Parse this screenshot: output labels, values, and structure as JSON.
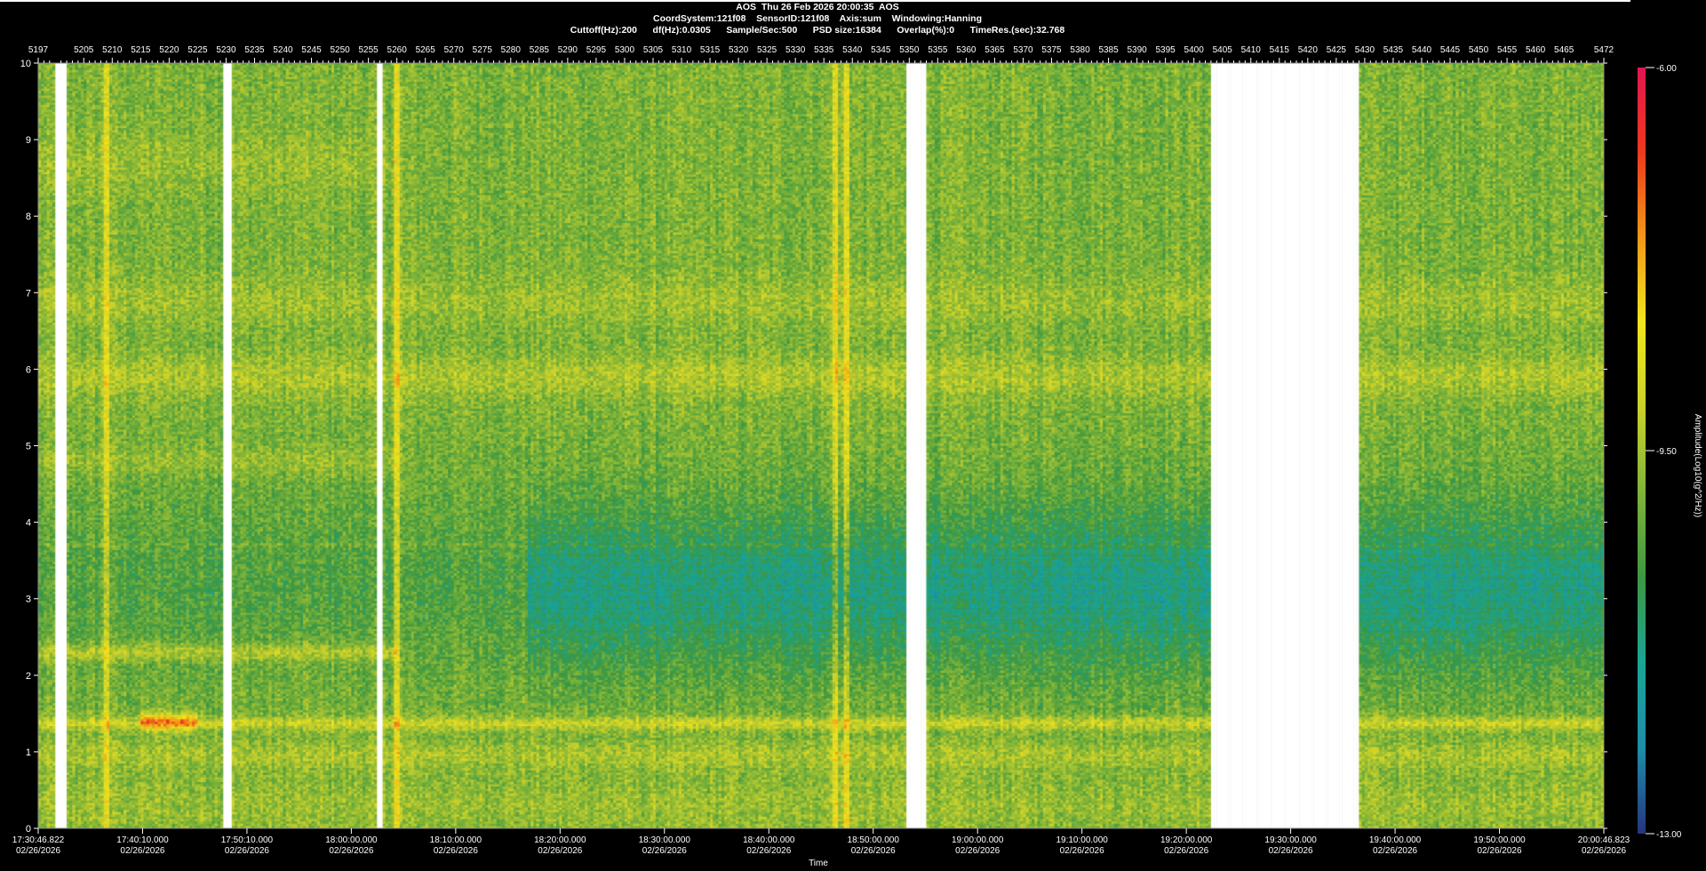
{
  "header": {
    "line1": "AOS  Thu 26 Feb 2026 20:00:35  AOS",
    "line2": "CoordSystem:121f08    SensorID:121f08    Axis:sum    Windowing:Hanning",
    "line3": "Cuttoff(Hz):200      df(Hz):0.0305      Sample/Sec:500      PSD size:16384      Overlap(%):0      TimeRes.(sec):32.768"
  },
  "chart_data": {
    "type": "heatmap",
    "title": "AOS  Thu 26 Feb 2026 20:00:35  AOS",
    "xlabel": "Time",
    "ylabel": "",
    "colorbar_label": "Amplitude(Log10(g^2/Hz))",
    "ylim": [
      0,
      10
    ],
    "yticks": [
      0,
      1,
      2,
      3,
      4,
      5,
      6,
      7,
      8,
      9,
      10
    ],
    "top_index_range": [
      5197,
      5472
    ],
    "top_ticks": [
      5197,
      5205,
      5210,
      5215,
      5220,
      5225,
      5230,
      5235,
      5240,
      5245,
      5250,
      5255,
      5260,
      5265,
      5270,
      5275,
      5280,
      5285,
      5290,
      5295,
      5300,
      5305,
      5310,
      5315,
      5320,
      5325,
      5330,
      5335,
      5340,
      5345,
      5350,
      5355,
      5360,
      5365,
      5370,
      5375,
      5380,
      5385,
      5390,
      5395,
      5400,
      5405,
      5410,
      5415,
      5420,
      5425,
      5430,
      5435,
      5440,
      5445,
      5450,
      5455,
      5460,
      5465,
      5472
    ],
    "time_ticks": [
      {
        "time": "17:30:46.822",
        "date": "02/26/2026"
      },
      {
        "time": "17:40:10.000",
        "date": "02/26/2026"
      },
      {
        "time": "17:50:10.000",
        "date": "02/26/2026"
      },
      {
        "time": "18:00:00.000",
        "date": "02/26/2026"
      },
      {
        "time": "18:10:00.000",
        "date": "02/26/2026"
      },
      {
        "time": "18:20:00.000",
        "date": "02/26/2026"
      },
      {
        "time": "18:30:00.000",
        "date": "02/26/2026"
      },
      {
        "time": "18:40:00.000",
        "date": "02/26/2026"
      },
      {
        "time": "18:50:00.000",
        "date": "02/26/2026"
      },
      {
        "time": "19:00:00.000",
        "date": "02/26/2026"
      },
      {
        "time": "19:10:00.000",
        "date": "02/26/2026"
      },
      {
        "time": "19:20:00.000",
        "date": "02/26/2026"
      },
      {
        "time": "19:30:00.000",
        "date": "02/26/2026"
      },
      {
        "time": "19:40:00.000",
        "date": "02/26/2026"
      },
      {
        "time": "19:50:00.000",
        "date": "02/26/2026"
      },
      {
        "time": "20:00:46.823",
        "date": "02/26/2026"
      }
    ],
    "colorbar": {
      "min": -13.0,
      "max": -6.0,
      "tick_labels": [
        "-6.00",
        "-9.50",
        "-13.00"
      ],
      "tick_values": [
        -6.0,
        -9.5,
        -13.0
      ],
      "colors": [
        "#25357e",
        "#1f8da9",
        "#1aa596",
        "#3d9843",
        "#7fb43a",
        "#c9d12c",
        "#f0e61e",
        "#f29818",
        "#ec3a1e",
        "#e2164f"
      ]
    },
    "data_gaps": [
      [
        5200,
        5202
      ],
      [
        5229.5,
        5231
      ],
      [
        5256.5,
        5257.5
      ],
      [
        5349.5,
        5353
      ],
      [
        5403,
        5429
      ]
    ],
    "features": {
      "broadband_lines": [
        5209,
        5260,
        5337,
        5339
      ],
      "freq_bands_hz": [
        1.37,
        2.1,
        2.35,
        2.55,
        3.7,
        4.8,
        5.9,
        6.9,
        8.7
      ],
      "peak_value": -6.5
    }
  }
}
